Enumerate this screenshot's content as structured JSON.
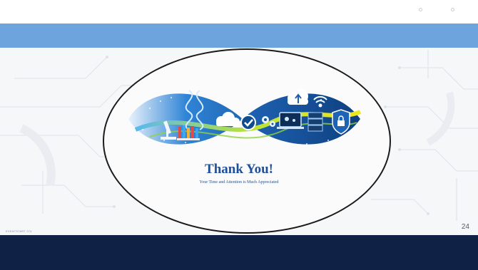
{
  "slide": {
    "title": "Thank You!",
    "subtitle": "Your Time and Attention is Much Appreciated",
    "page_number": "24",
    "footer_note": "EVENTSTART 274"
  },
  "colors": {
    "header_bar": "#6ea4dd",
    "footer_bar": "#0f2246",
    "title_text": "#1f4f99",
    "banner_blue": "#1f6fc4",
    "banner_green": "#7cc32a",
    "banner_yellow": "#e8e31c"
  },
  "banner_icons": [
    "dna-icon",
    "microscope-icon",
    "test-tubes-icon",
    "cloud-icon",
    "check-circle-icon",
    "gears-icon",
    "upload-cloud-icon",
    "wifi-icon",
    "laptop-icon",
    "server-icon",
    "lock-shield-icon"
  ]
}
